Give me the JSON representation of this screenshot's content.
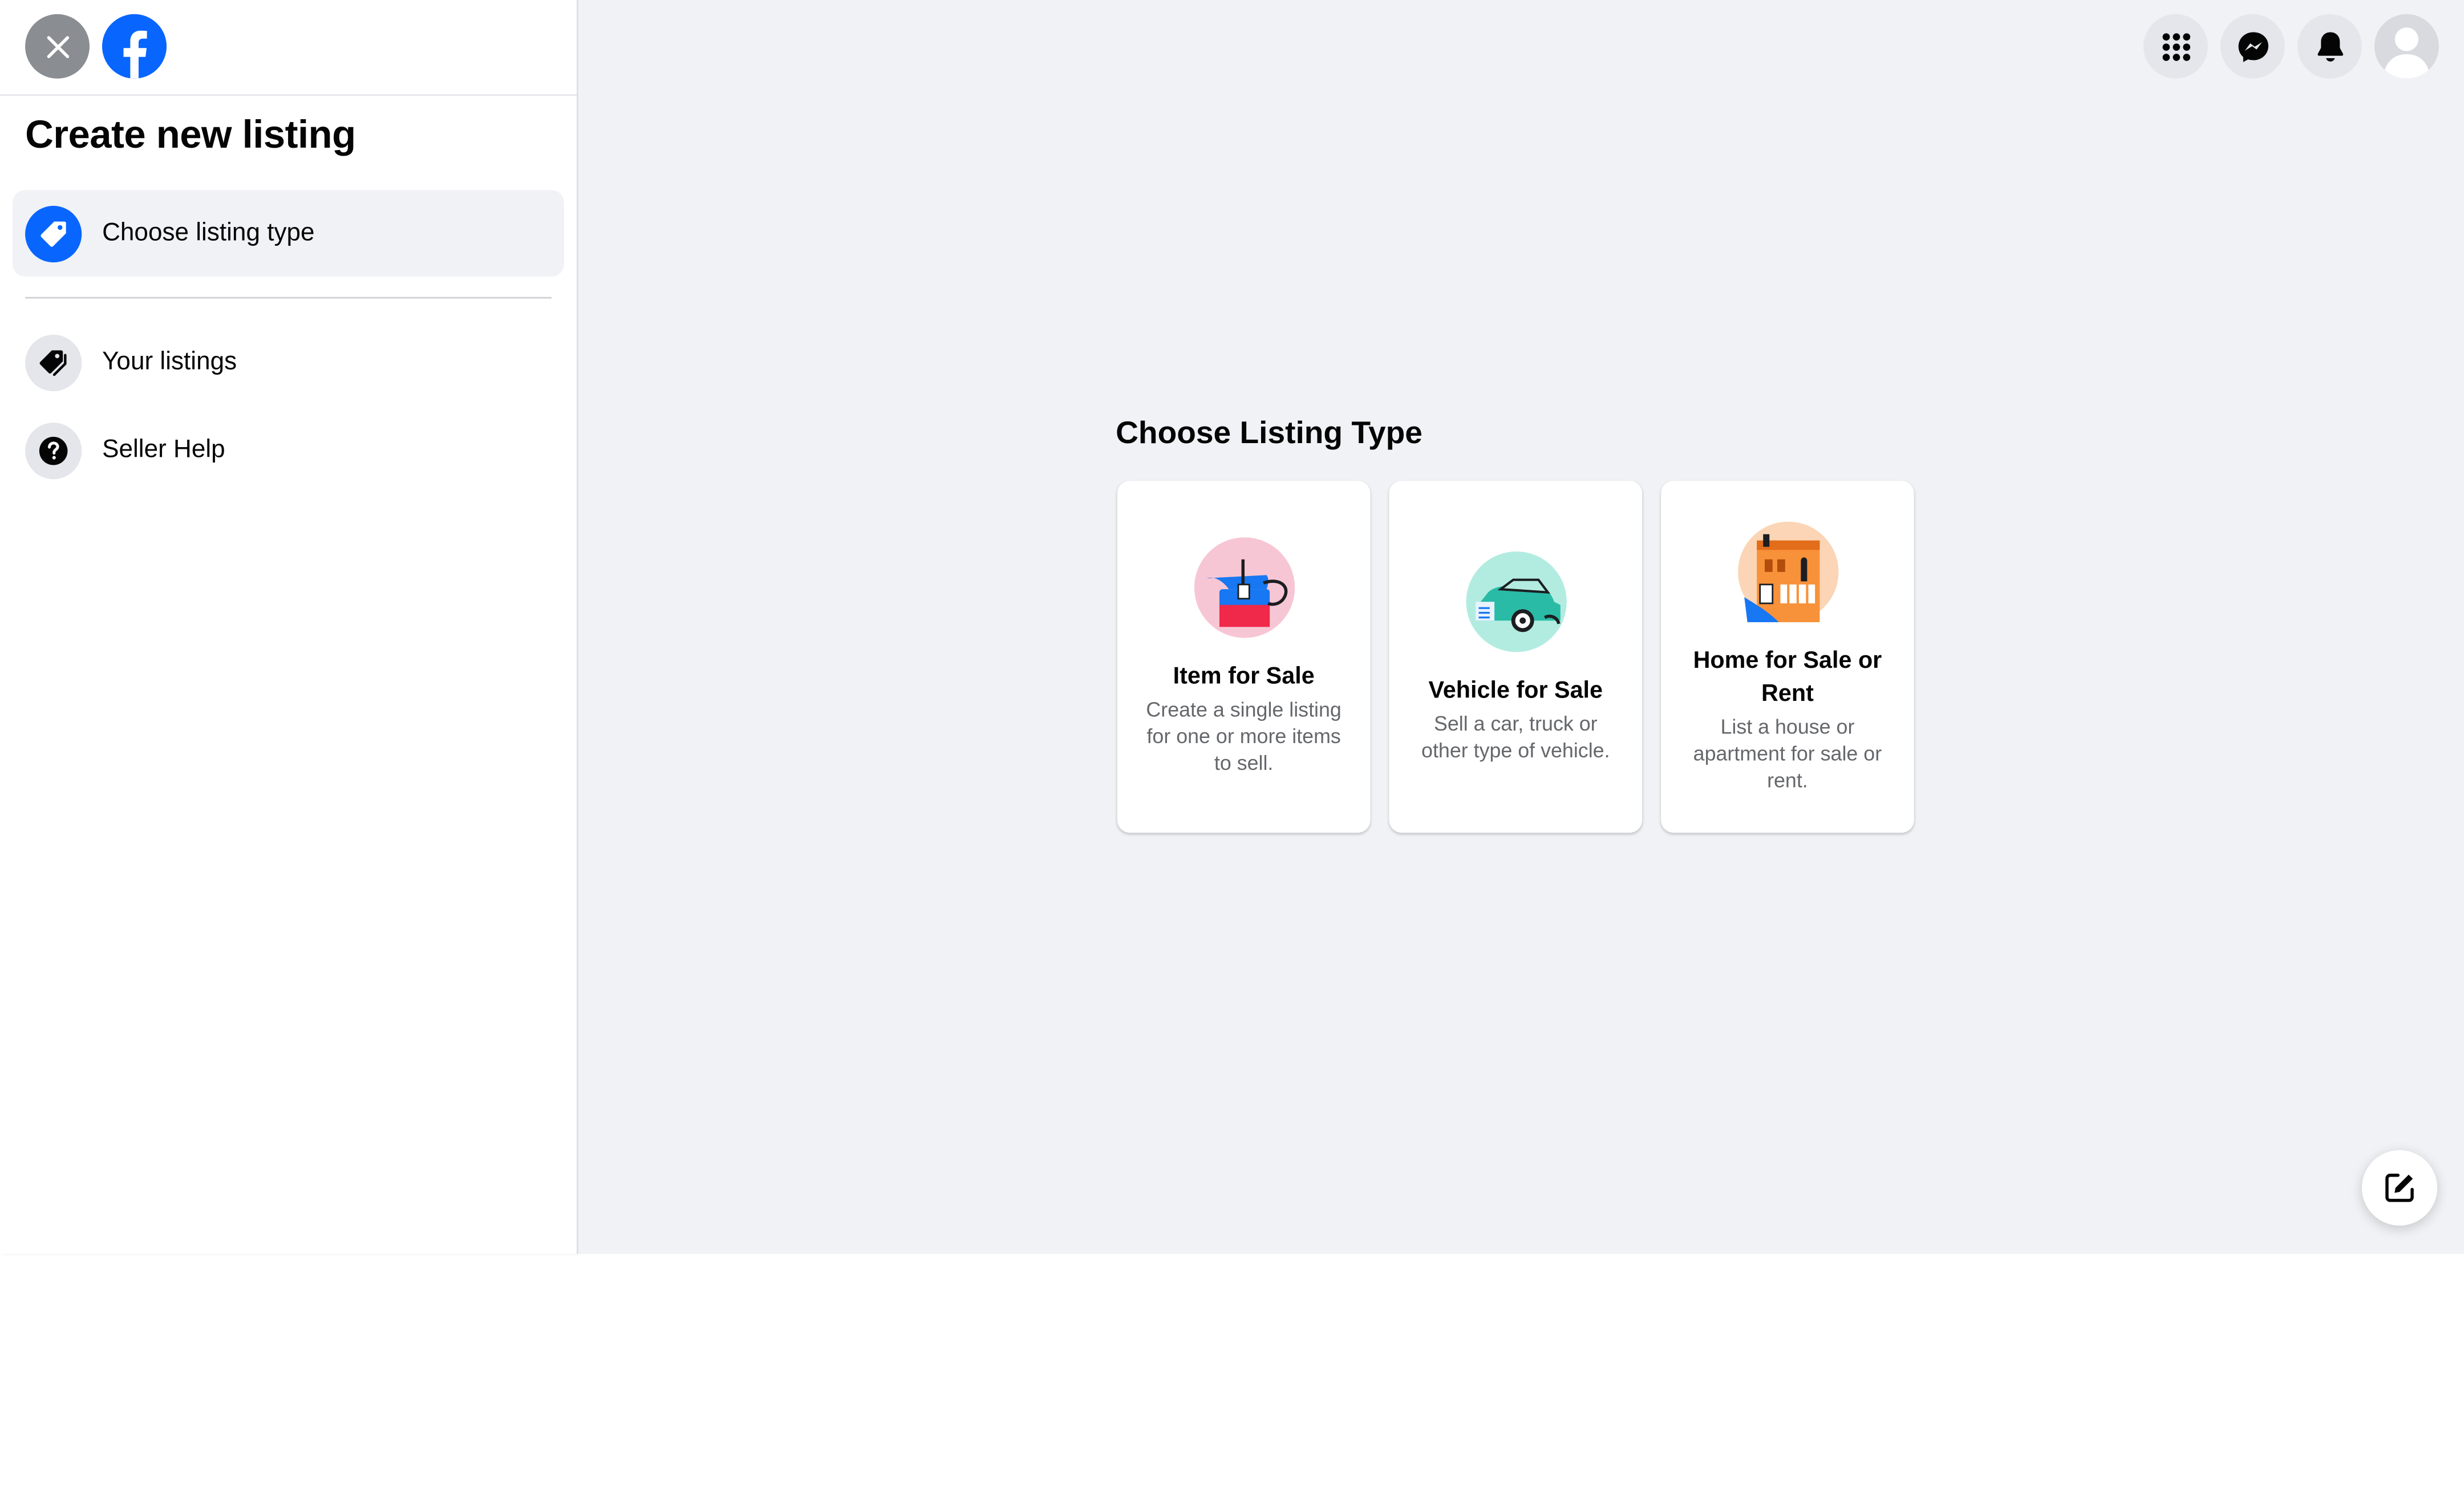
{
  "sidebar": {
    "title": "Create new listing",
    "items": [
      {
        "label": "Choose listing type",
        "icon": "tag-icon",
        "active": true
      },
      {
        "label": "Your listings",
        "icon": "tags-icon",
        "active": false
      },
      {
        "label": "Seller Help",
        "icon": "help-icon",
        "active": false
      }
    ]
  },
  "main": {
    "title": "Choose Listing Type",
    "cards": [
      {
        "title": "Item for Sale",
        "description": "Create a single listing for one or more items to sell.",
        "icon": "item-for-sale-icon"
      },
      {
        "title": "Vehicle for Sale",
        "description": "Sell a car, truck or other type of vehicle.",
        "icon": "vehicle-icon"
      },
      {
        "title": "Home for Sale or Rent",
        "description": "List a house or apartment for sale or rent.",
        "icon": "home-icon"
      }
    ]
  },
  "header_icons": [
    "menu-grid-icon",
    "messenger-icon",
    "notifications-icon",
    "profile-avatar"
  ],
  "colors": {
    "brand_blue": "#0866ff",
    "page_bg": "#f0f2f5",
    "secondary_text": "#65676b"
  }
}
